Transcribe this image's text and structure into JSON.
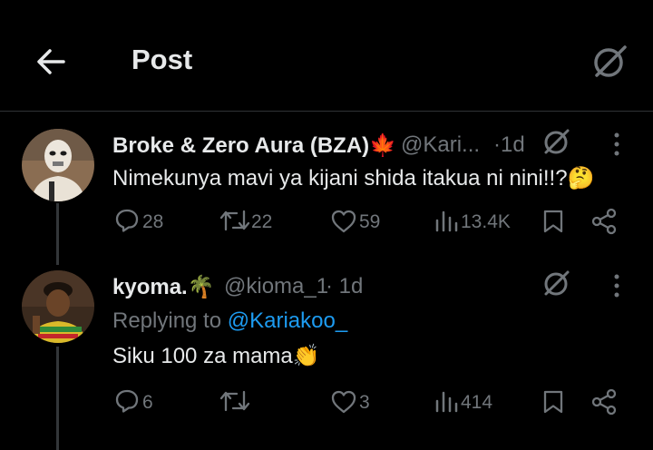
{
  "header": {
    "title": "Post"
  },
  "posts": [
    {
      "author_name": "Broke & Zero Aura (BZA)",
      "author_emoji": "🍁",
      "handle": "@Kari...",
      "sep": "·",
      "time": "1d",
      "text": "Nimekunya mavi ya kijani shida itakua ni nini!!?",
      "text_emoji": "🤔",
      "stats": {
        "replies": "28",
        "reposts": "22",
        "likes": "59",
        "views": "13.4K"
      }
    },
    {
      "author_name": "kyoma.",
      "author_emoji": "🌴",
      "handle": "@kioma_1",
      "sep": "·",
      "time": "1d",
      "replying_prefix": "Replying to ",
      "replying_handle": "@Kariakoo_",
      "text": "Siku 100 za mama",
      "text_emoji": "👏",
      "stats": {
        "replies": "6",
        "reposts": "",
        "likes": "3",
        "views": "414"
      }
    }
  ],
  "icons": {
    "back": "arrow-left-icon",
    "grok": "grok-icon",
    "more": "more-dots-icon",
    "reply": "reply-icon",
    "repost": "repost-icon",
    "like": "heart-icon",
    "views": "views-icon",
    "bookmark": "bookmark-icon",
    "share": "share-icon"
  },
  "colors": {
    "background": "#000000",
    "text": "#e7e9ea",
    "muted": "#71767b",
    "link": "#1d9bf0"
  }
}
